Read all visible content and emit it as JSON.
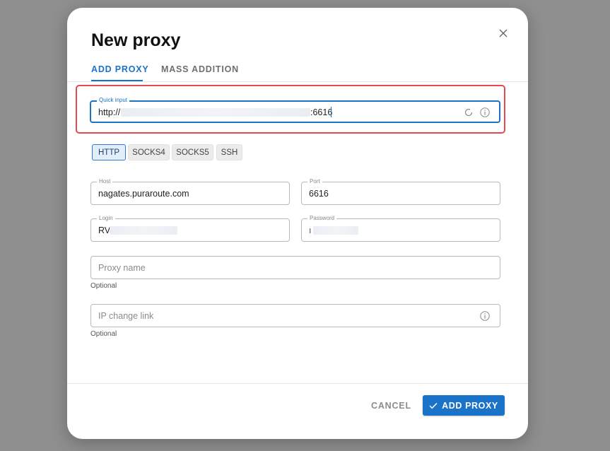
{
  "dialog": {
    "title": "New proxy",
    "close_icon": "close-icon"
  },
  "tabs": [
    {
      "label": "ADD PROXY",
      "active": true
    },
    {
      "label": "MASS ADDITION",
      "active": false
    }
  ],
  "quick_input": {
    "label": "Quick input",
    "value_prefix": "http://",
    "value_suffix": ":6616",
    "icons": [
      "refresh-icon",
      "info-icon"
    ]
  },
  "protocols": [
    {
      "label": "HTTP",
      "selected": true
    },
    {
      "label": "SOCKS4",
      "selected": false
    },
    {
      "label": "SOCKS5",
      "selected": false
    },
    {
      "label": "SSH",
      "selected": false
    }
  ],
  "host": {
    "label": "Host",
    "value": "nagates.puraroute.com"
  },
  "port": {
    "label": "Port",
    "value": "6616"
  },
  "login": {
    "label": "Login",
    "value": "RV"
  },
  "password": {
    "label": "Password",
    "value": "ı"
  },
  "proxy_name": {
    "placeholder": "Proxy name",
    "helper": "Optional"
  },
  "ip_change_link": {
    "placeholder": "IP change link",
    "helper": "Optional",
    "icon": "info-icon"
  },
  "footer": {
    "cancel_label": "CANCEL",
    "submit_label": "ADD PROXY",
    "submit_icon": "check-icon"
  },
  "colors": {
    "accent": "#1a73c8",
    "highlight": "#e24b4b",
    "backdrop": "#8f8f8f"
  }
}
